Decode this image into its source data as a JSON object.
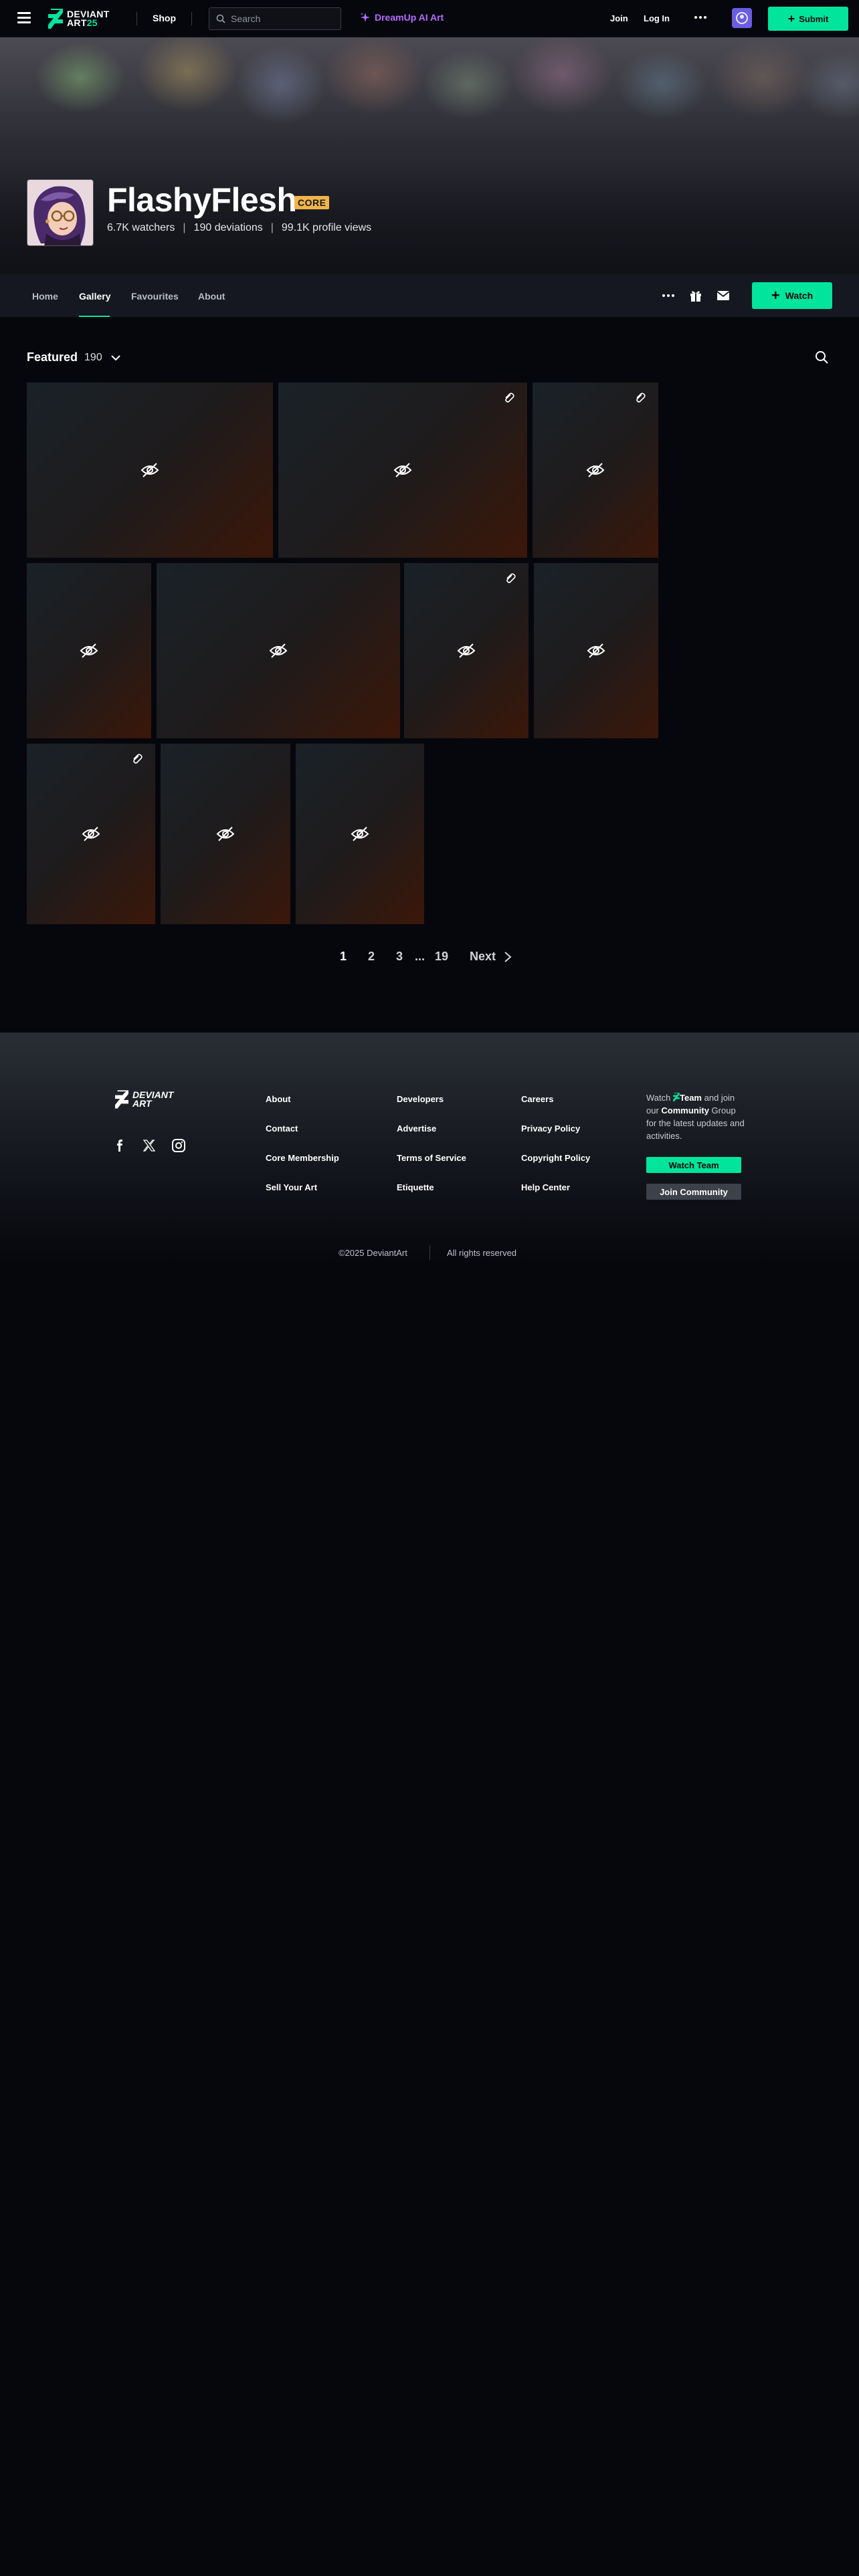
{
  "header": {
    "logo_line1": "DEVIANT",
    "logo_line2": "ART",
    "logo_num": "25",
    "shop_label": "Shop",
    "search_placeholder": "Search",
    "dreamup_label": "DreamUp AI Art",
    "join_label": "Join",
    "login_label": "Log In",
    "submit_label": "Submit"
  },
  "profile": {
    "username": "FlashyFlesh",
    "badge": "CORE",
    "watchers": "6.7K watchers",
    "deviations": "190 deviations",
    "views": "99.1K profile views",
    "stat_sep": "|"
  },
  "tabs": [
    {
      "label": "Home"
    },
    {
      "label": "Gallery"
    },
    {
      "label": "Favourites"
    },
    {
      "label": "About"
    }
  ],
  "watch_label": "Watch",
  "gallery": {
    "title": "Featured",
    "count": "190"
  },
  "pagination": {
    "pages": [
      "1",
      "2",
      "3",
      "...",
      "19"
    ],
    "current": "1",
    "next_label": "Next"
  },
  "footer": {
    "logo_line1": "DEVIANT",
    "logo_line2": "ART",
    "links": [
      [
        "About",
        "Developers",
        "Careers"
      ],
      [
        "Contact",
        "Advertise",
        "Privacy Policy"
      ],
      [
        "Core Membership",
        "Terms of Service",
        "Copyright Policy"
      ],
      [
        "Sell Your Art",
        "Etiquette",
        "Help Center"
      ]
    ],
    "promo_watch": "Watch",
    "promo_team": "Team",
    "promo_and": "and join our",
    "promo_community": "Community",
    "promo_rest": "Group for the latest updates and activities.",
    "watch_team_label": "Watch Team",
    "join_community_label": "Join Community",
    "copyright": "©2025 DeviantArt",
    "rights": "All rights reserved"
  },
  "colors": {
    "accent": "#00e59b",
    "badge": "#f0b44a",
    "dreamup": "#b66bff",
    "background": "#06070d"
  }
}
